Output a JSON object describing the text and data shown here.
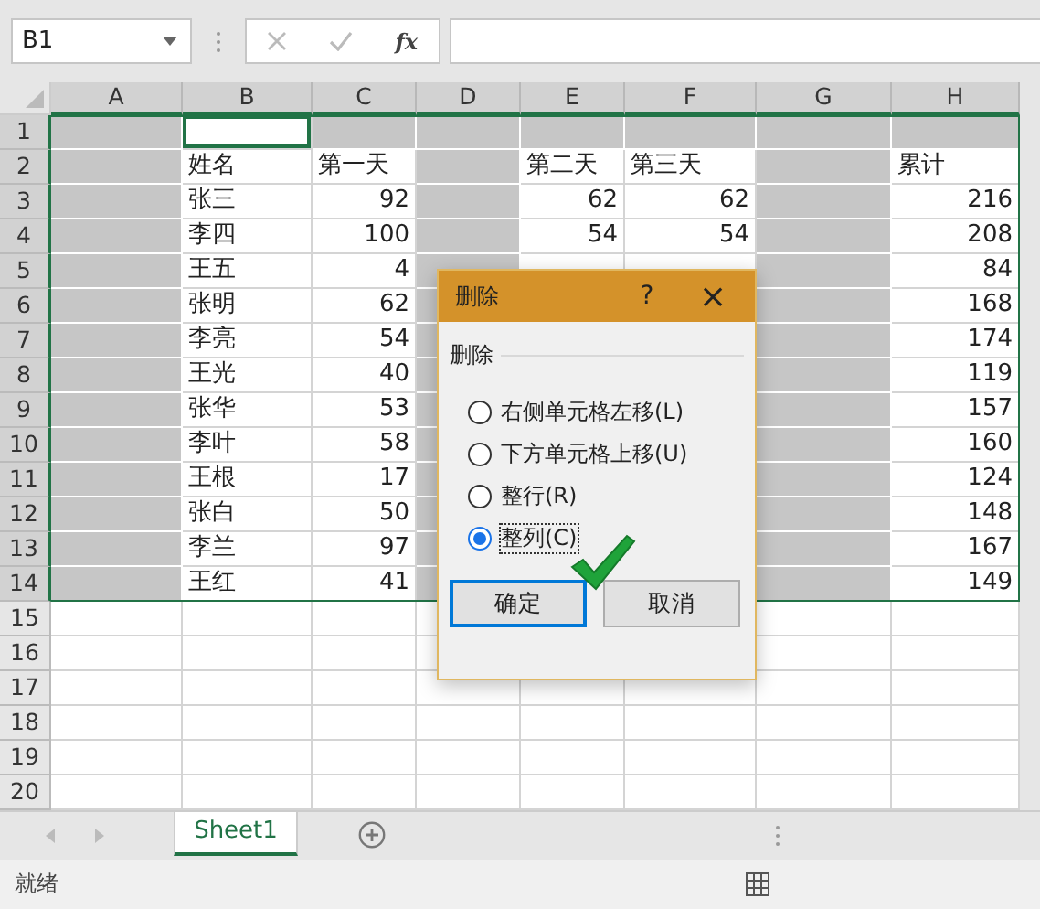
{
  "name_box": {
    "value": "B1"
  },
  "formula_bar": {
    "function_label": "fx"
  },
  "columns": [
    {
      "label": "A",
      "shaded": true,
      "active": false,
      "kind": "text"
    },
    {
      "label": "B",
      "shaded": false,
      "active": true,
      "kind": "text"
    },
    {
      "label": "C",
      "shaded": false,
      "active": false,
      "kind": "number"
    },
    {
      "label": "D",
      "shaded": true,
      "active": false,
      "kind": "text"
    },
    {
      "label": "E",
      "shaded": false,
      "active": false,
      "kind": "number"
    },
    {
      "label": "F",
      "shaded": false,
      "active": false,
      "kind": "number"
    },
    {
      "label": "G",
      "shaded": true,
      "active": false,
      "kind": "text"
    },
    {
      "label": "H",
      "shaded": false,
      "active": false,
      "kind": "number"
    }
  ],
  "rows": [
    {
      "number": "1",
      "selected": true,
      "shaded": true,
      "active": true,
      "kind": "data",
      "cells": [
        null,
        null,
        null,
        null,
        null,
        null,
        null,
        null
      ]
    },
    {
      "number": "2",
      "selected": true,
      "shaded": false,
      "active": false,
      "kind": "header",
      "cells": [
        null,
        "姓名",
        "第一天",
        null,
        "第二天",
        "第三天",
        null,
        "累计"
      ]
    },
    {
      "number": "3",
      "selected": true,
      "shaded": false,
      "active": false,
      "kind": "data",
      "cells": [
        null,
        "张三",
        "92",
        null,
        "62",
        "62",
        null,
        "216"
      ]
    },
    {
      "number": "4",
      "selected": true,
      "shaded": false,
      "active": false,
      "kind": "data",
      "cells": [
        null,
        "李四",
        "100",
        null,
        "54",
        "54",
        null,
        "208"
      ]
    },
    {
      "number": "5",
      "selected": true,
      "shaded": false,
      "active": false,
      "kind": "data",
      "cells": [
        null,
        "王五",
        "4",
        null,
        null,
        null,
        null,
        "84"
      ]
    },
    {
      "number": "6",
      "selected": true,
      "shaded": false,
      "active": false,
      "kind": "data",
      "cells": [
        null,
        "张明",
        "62",
        null,
        null,
        null,
        null,
        "168"
      ]
    },
    {
      "number": "7",
      "selected": true,
      "shaded": false,
      "active": false,
      "kind": "data",
      "cells": [
        null,
        "李亮",
        "54",
        null,
        null,
        null,
        null,
        "174"
      ]
    },
    {
      "number": "8",
      "selected": true,
      "shaded": false,
      "active": false,
      "kind": "data",
      "cells": [
        null,
        "王光",
        "40",
        null,
        null,
        null,
        null,
        "119"
      ]
    },
    {
      "number": "9",
      "selected": true,
      "shaded": false,
      "active": false,
      "kind": "data",
      "cells": [
        null,
        "张华",
        "53",
        null,
        null,
        null,
        null,
        "157"
      ]
    },
    {
      "number": "10",
      "selected": true,
      "shaded": false,
      "active": false,
      "kind": "data",
      "cells": [
        null,
        "李叶",
        "58",
        null,
        null,
        null,
        null,
        "160"
      ]
    },
    {
      "number": "11",
      "selected": true,
      "shaded": false,
      "active": false,
      "kind": "data",
      "cells": [
        null,
        "王根",
        "17",
        null,
        null,
        null,
        null,
        "124"
      ]
    },
    {
      "number": "12",
      "selected": true,
      "shaded": false,
      "active": false,
      "kind": "data",
      "cells": [
        null,
        "张白",
        "50",
        null,
        null,
        null,
        null,
        "148"
      ]
    },
    {
      "number": "13",
      "selected": true,
      "shaded": false,
      "active": false,
      "kind": "data",
      "cells": [
        null,
        "李兰",
        "97",
        null,
        null,
        null,
        null,
        "167"
      ]
    },
    {
      "number": "14",
      "selected": true,
      "shaded": false,
      "active": false,
      "kind": "data",
      "cells": [
        null,
        "王红",
        "41",
        null,
        null,
        null,
        null,
        "149"
      ]
    },
    {
      "number": "15",
      "selected": false,
      "shaded": false,
      "active": false,
      "kind": "data"
    },
    {
      "number": "16",
      "selected": false,
      "shaded": false,
      "active": false,
      "kind": "data"
    },
    {
      "number": "17",
      "selected": false,
      "shaded": false,
      "active": false,
      "kind": "data"
    },
    {
      "number": "18",
      "selected": false,
      "shaded": false,
      "active": false,
      "kind": "data"
    },
    {
      "number": "19",
      "selected": false,
      "shaded": false,
      "active": false,
      "kind": "data"
    },
    {
      "number": "20",
      "selected": false,
      "shaded": false,
      "active": false,
      "kind": "data"
    }
  ],
  "dialog": {
    "title": "删除",
    "help": "?",
    "close": "×",
    "group_label": "删除",
    "options": [
      {
        "label": "右侧单元格左移(L)",
        "selected": false
      },
      {
        "label": "下方单元格上移(U)",
        "selected": false
      },
      {
        "label": "整行(R)",
        "selected": false
      },
      {
        "label": "整列(C)",
        "selected": true
      }
    ],
    "buttons": [
      {
        "label": "确定",
        "default": true
      },
      {
        "label": "取消",
        "default": false
      }
    ]
  },
  "sheet_tabs": [
    {
      "label": "Sheet1",
      "selected": true
    }
  ],
  "status_bar": {
    "text": "就绪"
  }
}
